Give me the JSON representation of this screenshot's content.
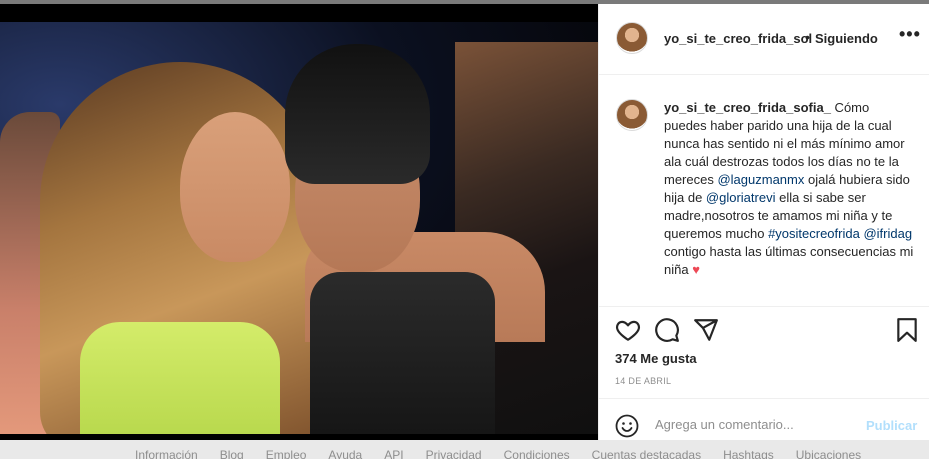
{
  "post": {
    "username": "yo_si_te_creo_frida_sol",
    "separator": "•",
    "follow_status": "Siguiendo",
    "more_options": "•••",
    "caption": {
      "username": "yo_si_te_creo_frida_sofia_",
      "text_1": " Cómo puedes haber parido una hija de la cual nunca has sentido ni el más mínimo amor ala cuál destrozas todos los días no te la mereces ",
      "mention_1": "@laguzmanmx",
      "text_2": " ojalá hubiera sido hija de ",
      "mention_2": "@gloriatrevi",
      "text_3": " ella si sabe ser madre,nosotros te amamos mi niña y te queremos mucho ",
      "hashtag": "#yositecreofrida",
      "text_4": " ",
      "mention_3": "@ifridag",
      "text_5": " contigo hasta las últimas consecuencias mi niña ",
      "emoji": "♥"
    },
    "likes": "374 Me gusta",
    "date": "14 DE ABRIL",
    "comment_placeholder": "Agrega un comentario...",
    "publish_label": "Publicar"
  },
  "footer": {
    "links": [
      "Información",
      "Blog",
      "Empleo",
      "Ayuda",
      "API",
      "Privacidad",
      "Condiciones",
      "Cuentas destacadas",
      "Hashtags",
      "Ubicaciones"
    ]
  },
  "icons": {
    "like": "heart-icon",
    "comment": "comment-icon",
    "share": "send-icon",
    "save": "bookmark-icon",
    "emoji": "smiley-icon"
  },
  "colors": {
    "link": "#00376b",
    "publish_disabled": "#b2dffc",
    "heart": "#ed4956"
  }
}
